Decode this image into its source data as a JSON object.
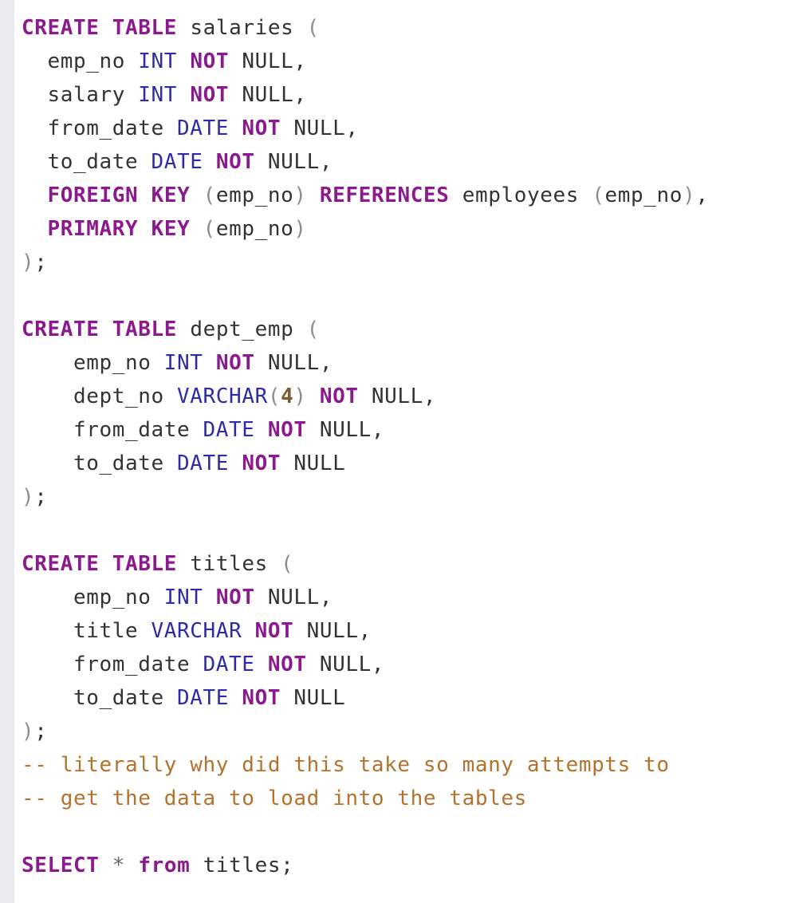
{
  "editor": {
    "language": "sql",
    "colors": {
      "keyword": "#8a1a8e",
      "type": "#2f2ba6",
      "punctuation": "#8c8c8c",
      "number": "#7a5c34",
      "comment": "#b5722c",
      "text": "#333333",
      "gutter": "#e9e9ef"
    },
    "lines": [
      [
        {
          "t": "kw",
          "v": "CREATE"
        },
        {
          "t": "plain",
          "v": " "
        },
        {
          "t": "kw",
          "v": "TABLE"
        },
        {
          "t": "plain",
          "v": " salaries "
        },
        {
          "t": "punct",
          "v": "("
        }
      ],
      [
        {
          "t": "plain",
          "v": "  emp_no "
        },
        {
          "t": "type",
          "v": "INT"
        },
        {
          "t": "plain",
          "v": " "
        },
        {
          "t": "kw",
          "v": "NOT"
        },
        {
          "t": "plain",
          "v": " NULL,"
        }
      ],
      [
        {
          "t": "plain",
          "v": "  salary "
        },
        {
          "t": "type",
          "v": "INT"
        },
        {
          "t": "plain",
          "v": " "
        },
        {
          "t": "kw",
          "v": "NOT"
        },
        {
          "t": "plain",
          "v": " NULL,"
        }
      ],
      [
        {
          "t": "plain",
          "v": "  from_date "
        },
        {
          "t": "type",
          "v": "DATE"
        },
        {
          "t": "plain",
          "v": " "
        },
        {
          "t": "kw",
          "v": "NOT"
        },
        {
          "t": "plain",
          "v": " NULL,"
        }
      ],
      [
        {
          "t": "plain",
          "v": "  to_date "
        },
        {
          "t": "type",
          "v": "DATE"
        },
        {
          "t": "plain",
          "v": " "
        },
        {
          "t": "kw",
          "v": "NOT"
        },
        {
          "t": "plain",
          "v": " NULL,"
        }
      ],
      [
        {
          "t": "plain",
          "v": "  "
        },
        {
          "t": "kw",
          "v": "FOREIGN"
        },
        {
          "t": "plain",
          "v": " "
        },
        {
          "t": "kw",
          "v": "KEY"
        },
        {
          "t": "plain",
          "v": " "
        },
        {
          "t": "punct",
          "v": "("
        },
        {
          "t": "plain",
          "v": "emp_no"
        },
        {
          "t": "punct",
          "v": ")"
        },
        {
          "t": "plain",
          "v": " "
        },
        {
          "t": "kw",
          "v": "REFERENCES"
        },
        {
          "t": "plain",
          "v": " employees "
        },
        {
          "t": "punct",
          "v": "("
        },
        {
          "t": "plain",
          "v": "emp_no"
        },
        {
          "t": "punct",
          "v": ")"
        },
        {
          "t": "plain",
          "v": ","
        }
      ],
      [
        {
          "t": "plain",
          "v": "  "
        },
        {
          "t": "kw",
          "v": "PRIMARY"
        },
        {
          "t": "plain",
          "v": " "
        },
        {
          "t": "kw",
          "v": "KEY"
        },
        {
          "t": "plain",
          "v": " "
        },
        {
          "t": "punct",
          "v": "("
        },
        {
          "t": "plain",
          "v": "emp_no"
        },
        {
          "t": "punct",
          "v": ")"
        }
      ],
      [
        {
          "t": "punct",
          "v": ")"
        },
        {
          "t": "plain",
          "v": ";"
        }
      ],
      [],
      [
        {
          "t": "kw",
          "v": "CREATE"
        },
        {
          "t": "plain",
          "v": " "
        },
        {
          "t": "kw",
          "v": "TABLE"
        },
        {
          "t": "plain",
          "v": " dept_emp "
        },
        {
          "t": "punct",
          "v": "("
        }
      ],
      [
        {
          "t": "plain",
          "v": "    emp_no "
        },
        {
          "t": "type",
          "v": "INT"
        },
        {
          "t": "plain",
          "v": " "
        },
        {
          "t": "kw",
          "v": "NOT"
        },
        {
          "t": "plain",
          "v": " NULL,"
        }
      ],
      [
        {
          "t": "plain",
          "v": "    dept_no "
        },
        {
          "t": "type",
          "v": "VARCHAR"
        },
        {
          "t": "punct",
          "v": "("
        },
        {
          "t": "num",
          "v": "4"
        },
        {
          "t": "punct",
          "v": ")"
        },
        {
          "t": "plain",
          "v": " "
        },
        {
          "t": "kw",
          "v": "NOT"
        },
        {
          "t": "plain",
          "v": " NULL,"
        }
      ],
      [
        {
          "t": "plain",
          "v": "    from_date "
        },
        {
          "t": "type",
          "v": "DATE"
        },
        {
          "t": "plain",
          "v": " "
        },
        {
          "t": "kw",
          "v": "NOT"
        },
        {
          "t": "plain",
          "v": " NULL,"
        }
      ],
      [
        {
          "t": "plain",
          "v": "    to_date "
        },
        {
          "t": "type",
          "v": "DATE"
        },
        {
          "t": "plain",
          "v": " "
        },
        {
          "t": "kw",
          "v": "NOT"
        },
        {
          "t": "plain",
          "v": " NULL"
        }
      ],
      [
        {
          "t": "punct",
          "v": ")"
        },
        {
          "t": "plain",
          "v": ";"
        }
      ],
      [],
      [
        {
          "t": "kw",
          "v": "CREATE"
        },
        {
          "t": "plain",
          "v": " "
        },
        {
          "t": "kw",
          "v": "TABLE"
        },
        {
          "t": "plain",
          "v": " titles "
        },
        {
          "t": "punct",
          "v": "("
        }
      ],
      [
        {
          "t": "plain",
          "v": "    emp_no "
        },
        {
          "t": "type",
          "v": "INT"
        },
        {
          "t": "plain",
          "v": " "
        },
        {
          "t": "kw",
          "v": "NOT"
        },
        {
          "t": "plain",
          "v": " NULL,"
        }
      ],
      [
        {
          "t": "plain",
          "v": "    title "
        },
        {
          "t": "type",
          "v": "VARCHAR"
        },
        {
          "t": "plain",
          "v": " "
        },
        {
          "t": "kw",
          "v": "NOT"
        },
        {
          "t": "plain",
          "v": " NULL,"
        }
      ],
      [
        {
          "t": "plain",
          "v": "    from_date "
        },
        {
          "t": "type",
          "v": "DATE"
        },
        {
          "t": "plain",
          "v": " "
        },
        {
          "t": "kw",
          "v": "NOT"
        },
        {
          "t": "plain",
          "v": " NULL,"
        }
      ],
      [
        {
          "t": "plain",
          "v": "    to_date "
        },
        {
          "t": "type",
          "v": "DATE"
        },
        {
          "t": "plain",
          "v": " "
        },
        {
          "t": "kw",
          "v": "NOT"
        },
        {
          "t": "plain",
          "v": " NULL"
        }
      ],
      [
        {
          "t": "punct",
          "v": ")"
        },
        {
          "t": "plain",
          "v": ";"
        }
      ],
      [
        {
          "t": "comment",
          "v": "-- literally why did this take so many attempts to"
        }
      ],
      [
        {
          "t": "comment",
          "v": "-- get the data to load into the tables"
        }
      ],
      [],
      [
        {
          "t": "kw",
          "v": "SELECT"
        },
        {
          "t": "plain",
          "v": " "
        },
        {
          "t": "op",
          "v": "*"
        },
        {
          "t": "plain",
          "v": " "
        },
        {
          "t": "kw",
          "v": "from"
        },
        {
          "t": "plain",
          "v": " titles;"
        }
      ]
    ]
  }
}
